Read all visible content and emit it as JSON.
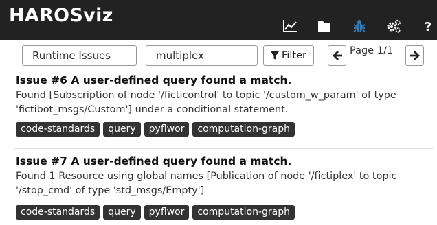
{
  "app": {
    "title": "HAROSviz"
  },
  "nav": {
    "icons": [
      "line-chart-icon",
      "folder-icon",
      "bug-icon",
      "gears-icon",
      "help-icon"
    ],
    "active_color": "#337ab7",
    "help_label": "?"
  },
  "toolbar": {
    "issue_source": "Runtime Issues",
    "search_value": "multiplex",
    "filter_label": "Filter",
    "page_label": "Page 1/1"
  },
  "issues": [
    {
      "title": "Issue #6 A user-defined query found a match.",
      "description": "Found [Subscription of node '/ficticontrol' to topic '/custom_w_param' of type 'fictibot_msgs/Custom'] under a conditional statement.",
      "tags": [
        "code-standards",
        "query",
        "pyflwor",
        "computation-graph"
      ]
    },
    {
      "title": "Issue #7 A user-defined query found a match.",
      "description": "Found 1 Resource using global names [Publication of node '/fictiplex' to topic '/stop_cmd' of type 'std_msgs/Empty']",
      "tags": [
        "code-standards",
        "query",
        "pyflwor",
        "computation-graph"
      ]
    }
  ]
}
